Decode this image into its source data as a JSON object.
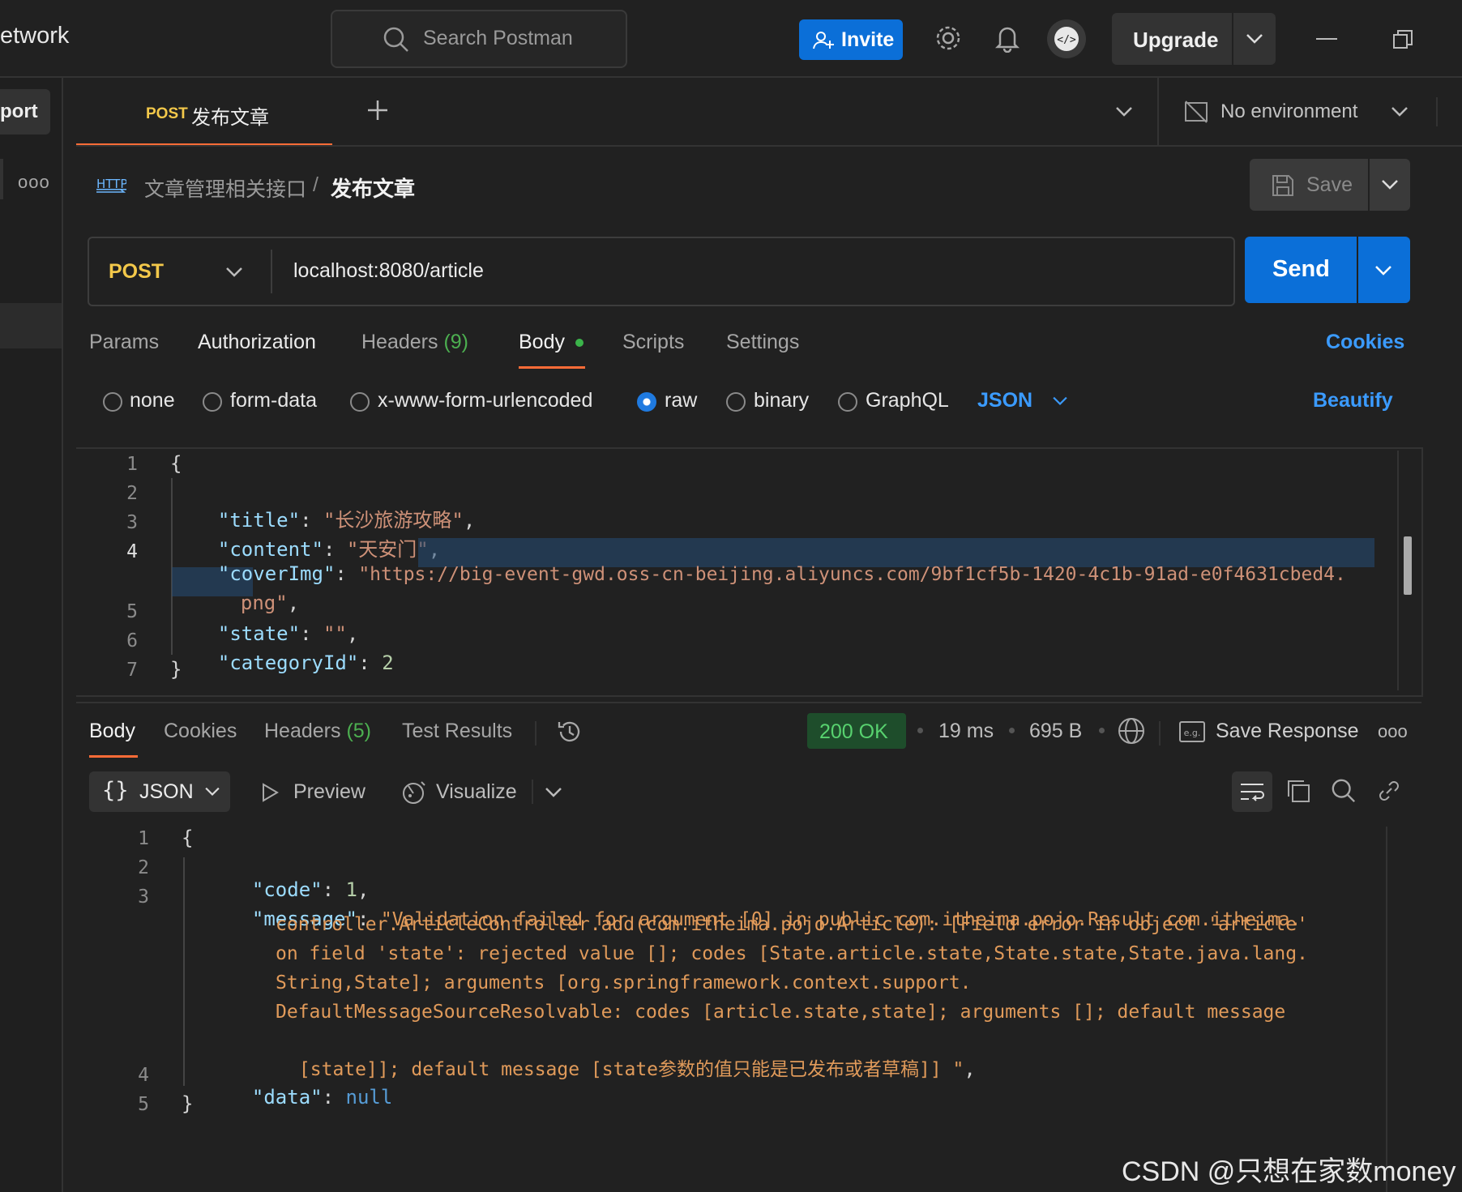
{
  "app": {
    "partial_title": "etwork",
    "import_partial": "port"
  },
  "search": {
    "placeholder": "Search Postman"
  },
  "topbar": {
    "invite_label": "Invite",
    "upgrade_label": "Upgrade"
  },
  "request_tab": {
    "method": "POST",
    "name": "发布文章"
  },
  "environment": {
    "label": "No environment"
  },
  "breadcrumb": {
    "collection": "文章管理相关接口",
    "separator": "/",
    "current": "发布文章"
  },
  "save": {
    "label": "Save"
  },
  "request": {
    "method": "POST",
    "url": "localhost:8080/article",
    "send_label": "Send"
  },
  "req_tabs": {
    "params": "Params",
    "authorization": "Authorization",
    "headers": "Headers",
    "headers_count": "(9)",
    "body": "Body",
    "scripts": "Scripts",
    "settings": "Settings",
    "cookies": "Cookies"
  },
  "body_types": {
    "none": "none",
    "form_data": "form-data",
    "urlencoded": "x-www-form-urlencoded",
    "raw": "raw",
    "binary": "binary",
    "graphql": "GraphQL",
    "selected": "raw",
    "format": "JSON",
    "beautify": "Beautify"
  },
  "request_body": {
    "line_numbers": [
      "1",
      "2",
      "3",
      "4",
      "5",
      "6",
      "7"
    ],
    "open": "{",
    "title_key": "\"title\"",
    "title_val": "\"长沙旅游攻略\"",
    "content_key": "\"content\"",
    "content_val": "\"天安门\"",
    "cover_key": "\"coverImg\"",
    "cover_val_1": "\"https://big-event-gwd.oss-cn-beijing.aliyuncs.com/9bf1cf5b-1420-4c1b-91ad-e0f4631cbed4.",
    "cover_val_2": "png\"",
    "state_key": "\"state\"",
    "state_val": "\"\"",
    "category_key": "\"categoryId\"",
    "category_val": "2",
    "close": "}"
  },
  "response": {
    "tabs": {
      "body": "Body",
      "cookies": "Cookies",
      "headers": "Headers",
      "headers_count": "(5)",
      "test_results": "Test Results"
    },
    "status": "200 OK",
    "time": "19 ms",
    "size": "695 B",
    "save_response": "Save Response",
    "view": {
      "format": "JSON",
      "preview": "Preview",
      "visualize": "Visualize"
    },
    "line_numbers": [
      "1",
      "2",
      "3",
      "4",
      "5"
    ],
    "open": "{",
    "code_key": "\"code\"",
    "code_val": "1",
    "message_key": "\"message\"",
    "message_lines": [
      "\"Validation failed for argument [0] in public com.itheima.pojo.Result com.itheima.",
      "controller.ArticleController.add(com.itheima.pojo.Article): [Field error in object 'article'",
      "on field 'state': rejected value []; codes [State.article.state,State.state,State.java.lang.",
      "String,State]; arguments [org.springframework.context.support.",
      "DefaultMessageSourceResolvable: codes [article.state,state]; arguments []; default message",
      "[state]]; default message [state参数的值只能是已发布或者草稿]] \""
    ],
    "data_key": "\"data\"",
    "data_val": "null",
    "close": "}"
  },
  "watermark": "CSDN @只想在家数money",
  "colors": {
    "accent_blue": "#0b6fd8",
    "status_green": "#1e4d2b",
    "method_yellow": "#f3c84a",
    "active_tab_underline": "#ff6c37"
  }
}
